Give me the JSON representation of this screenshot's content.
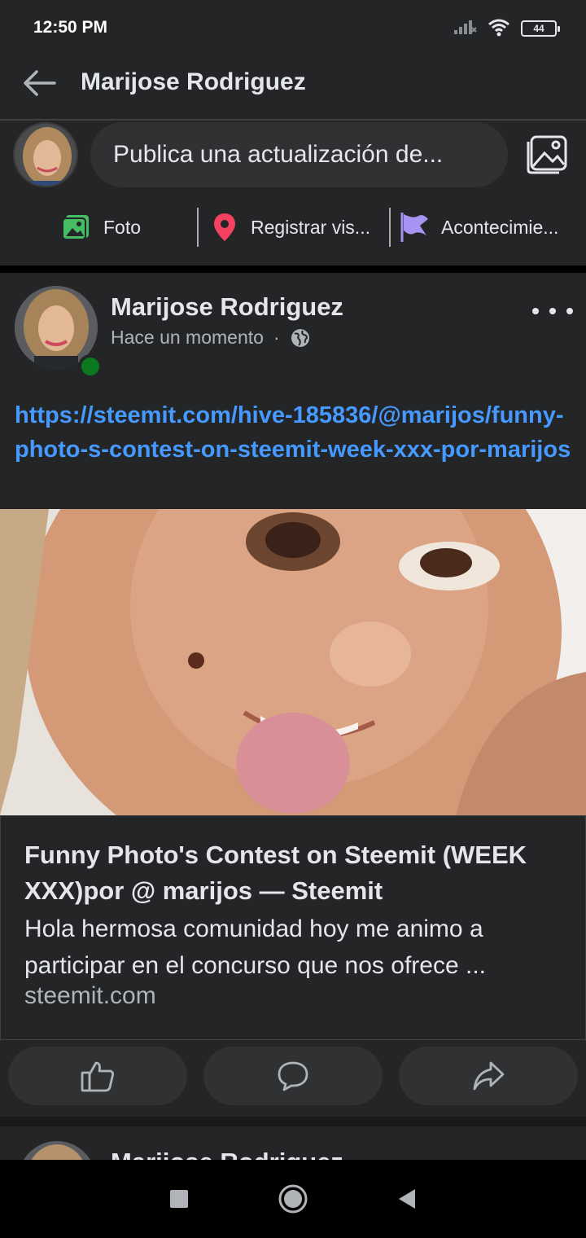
{
  "status_bar": {
    "time": "12:50 PM",
    "battery": "44",
    "icons": [
      "signal-icon",
      "wifi-icon",
      "battery-icon"
    ]
  },
  "header": {
    "title": "Marijose Rodriguez",
    "back_icon": "arrow-left-icon"
  },
  "composer": {
    "placeholder": "Publica una actualización de...",
    "actions": [
      {
        "label": "Foto",
        "icon": "photo-icon",
        "color": "#45bd62"
      },
      {
        "label": "Registrar vis...",
        "icon": "location-pin-icon",
        "color": "#f3425f"
      },
      {
        "label": "Acontecimie...",
        "icon": "flag-icon",
        "color": "#a693f2"
      }
    ]
  },
  "post": {
    "author": "Marijose Rodriguez",
    "time": "Hace un momento",
    "separator": "·",
    "privacy_icon": "globe-icon",
    "link_text": "https://steemit.com/hive-185836/@marijos/funny-photo-s-contest-on-steemit-week-xxx-por-marijos",
    "card": {
      "title": "Funny Photo's Contest on Steemit (WEEK XXX)por @ marijos — Steemit",
      "description": "Hola hermosa comunidad hoy me animo a participar en el concurso que nos ofrece ...",
      "domain": "steemit.com"
    },
    "reaction_buttons": [
      "like-icon",
      "comment-icon",
      "share-icon"
    ]
  },
  "next_post": {
    "author": "Marijose Rodriguez"
  },
  "colors": {
    "background": "#242526",
    "link": "#4599ff",
    "online": "#0b7a1f"
  }
}
